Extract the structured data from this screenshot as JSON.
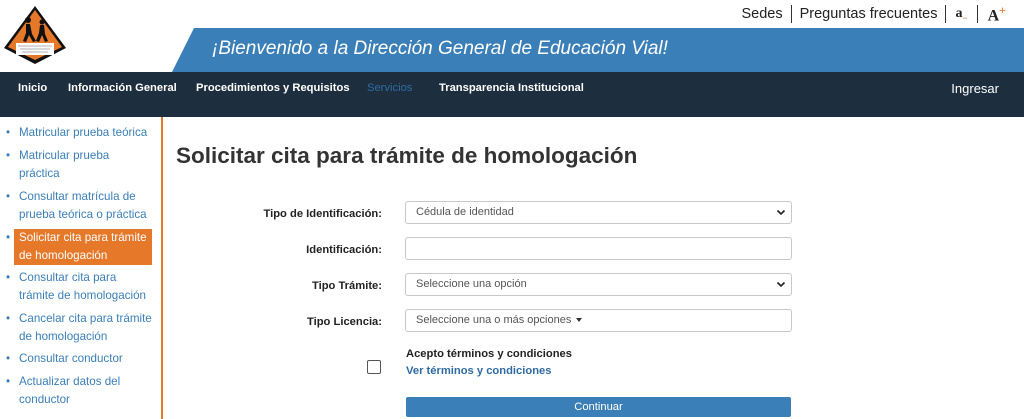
{
  "header": {
    "utility_links": [
      "Sedes",
      "Preguntas frecuentes"
    ],
    "font_decrease_label": "a",
    "font_decrease_sign": "−",
    "font_increase_label": "A",
    "font_increase_sign": "+",
    "banner_text": "¡Bienvenido a la Dirección General de Educación Vial!",
    "logo_icon": "road-safety-logo-icon",
    "colors": {
      "banner": "#3a7fb7",
      "accent": "#e6782a",
      "nav": "#1d2f3e"
    }
  },
  "nav": {
    "items": [
      "Inicio",
      "Información General",
      "Procedimientos y Requisitos",
      "Servicios",
      "Transparencia Institucional"
    ],
    "active": "Servicios",
    "login": "Ingresar"
  },
  "sidebar": {
    "items": [
      "Matricular prueba teórica",
      "Matricular prueba práctica",
      "Consultar matrícula de prueba teórica o práctica",
      "Solicitar cita para trámite de homologación",
      "Consultar cita para trámite de homologación",
      "Cancelar cita para trámite de homologación",
      "Consultar conductor",
      "Actualizar datos del conductor"
    ],
    "active_index": 3
  },
  "form": {
    "title": "Solicitar cita para trámite de homologación",
    "id_type_label": "Tipo de Identificación:",
    "id_type_value": "Cédula de identidad",
    "id_label": "Identificación:",
    "id_value": "",
    "procedure_label": "Tipo Trámite:",
    "procedure_value": "Seleccione una opción",
    "license_label": "Tipo Licencia:",
    "license_value": "Seleccione una o más opciones",
    "terms_label": "Acepto términos y condiciones",
    "terms_link": "Ver términos y condiciones",
    "terms_checked": false,
    "submit_label": "Continuar"
  }
}
